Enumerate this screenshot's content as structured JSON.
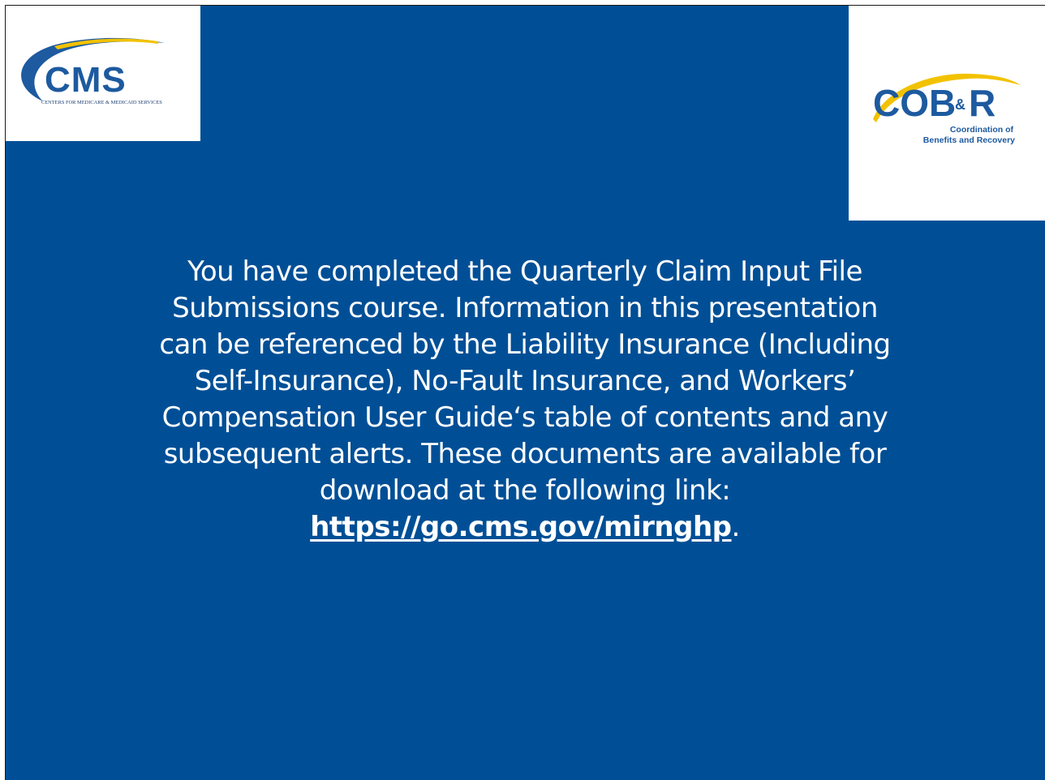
{
  "logos": {
    "cms": {
      "wordmark": "CMS",
      "tagline": "CENTERS FOR MEDICARE & MEDICAID SERVICES",
      "swoosh_color": "#1d5a9f",
      "accent_color": "#f2c200"
    },
    "cobr": {
      "wordmark_left": "COB",
      "wordmark_amp": "&",
      "wordmark_right": "R",
      "subtitle_line1": "Coordination of",
      "subtitle_line2": "Benefits and Recovery",
      "arc_color": "#f2c200",
      "text_color": "#1d5a9f"
    }
  },
  "slide": {
    "background_color": "#004f96",
    "message_lines": [
      "You have completed the Quarterly Claim Input File",
      "Submissions course. Information in this presentation",
      "can be referenced by the Liability Insurance (Including",
      "Self-Insurance), No-Fault Insurance, and Workers’",
      "Compensation User Guide‘s table of contents and any",
      "subsequent alerts. These documents are available for",
      "download at the following link:"
    ],
    "link_text": "https://go.cms.gov/mirnghp",
    "link_suffix": "."
  }
}
